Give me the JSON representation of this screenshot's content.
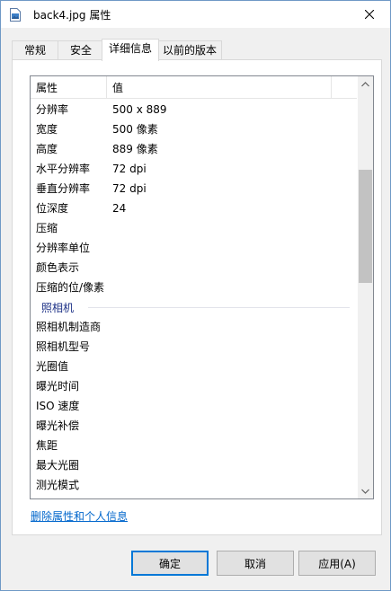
{
  "window": {
    "title": "back4.jpg 属性"
  },
  "tabs": [
    {
      "label": "常规"
    },
    {
      "label": "安全"
    },
    {
      "label": "详细信息"
    },
    {
      "label": "以前的版本"
    }
  ],
  "table": {
    "col_property": "属性",
    "col_value": "值",
    "rows": [
      {
        "k": "分辨率",
        "v": "500 x 889"
      },
      {
        "k": "宽度",
        "v": "500 像素"
      },
      {
        "k": "高度",
        "v": "889 像素"
      },
      {
        "k": "水平分辨率",
        "v": "72 dpi"
      },
      {
        "k": "垂直分辨率",
        "v": "72 dpi"
      },
      {
        "k": "位深度",
        "v": "24"
      },
      {
        "k": "压缩",
        "v": ""
      },
      {
        "k": "分辨率单位",
        "v": ""
      },
      {
        "k": "颜色表示",
        "v": ""
      },
      {
        "k": "压缩的位/像素",
        "v": ""
      }
    ],
    "group_camera": "照相机",
    "camera_rows": [
      {
        "k": "照相机制造商",
        "v": ""
      },
      {
        "k": "照相机型号",
        "v": ""
      },
      {
        "k": "光圈值",
        "v": ""
      },
      {
        "k": "曝光时间",
        "v": ""
      },
      {
        "k": "ISO 速度",
        "v": ""
      },
      {
        "k": "曝光补偿",
        "v": ""
      },
      {
        "k": "焦距",
        "v": ""
      },
      {
        "k": "最大光圈",
        "v": ""
      },
      {
        "k": "测光模式",
        "v": ""
      }
    ]
  },
  "link": "删除属性和个人信息",
  "buttons": {
    "ok": "确定",
    "cancel": "取消",
    "apply": "应用(A)"
  },
  "colors": {
    "accent": "#0078d7",
    "link": "#0066cc",
    "group_header": "#1e3287"
  }
}
